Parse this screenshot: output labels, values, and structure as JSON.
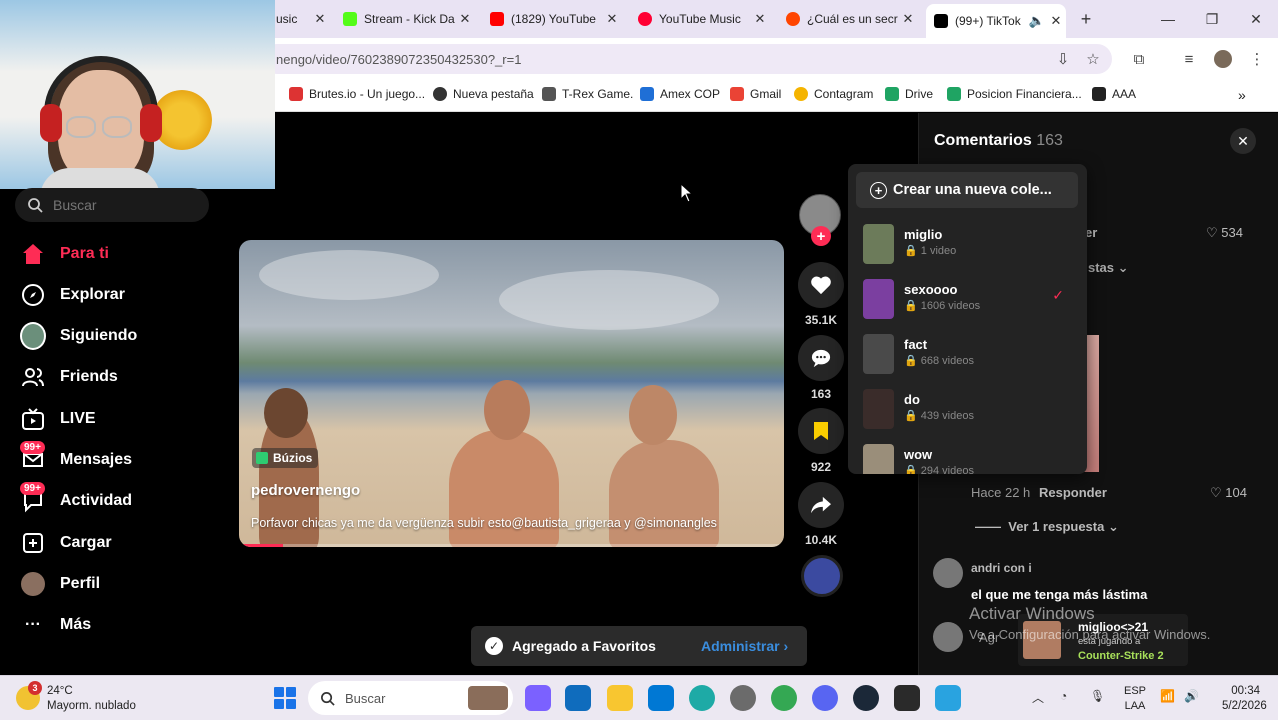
{
  "browser": {
    "tabs": [
      {
        "title": "usic",
        "favicon_color": "#ffffff"
      },
      {
        "title": "Stream - Kick Da",
        "favicon_color": "#53fc18"
      },
      {
        "title": "(1829) YouTube",
        "favicon_color": "#ff0000"
      },
      {
        "title": "YouTube Music",
        "favicon_color": "#ff0033"
      },
      {
        "title": "¿Cuál es un secr",
        "favicon_color": "#ff4500"
      },
      {
        "title": "(99+) TikTok",
        "favicon_color": "#000000"
      }
    ],
    "new_tab_symbol": "+",
    "url": "nengo/video/7602389072350432530?_r=1",
    "bookmarks": [
      {
        "label": "Brutes.io - Un juego...",
        "color": "#d33"
      },
      {
        "label": "Nueva pestaña",
        "color": "#333"
      },
      {
        "label": "T-Rex Game.",
        "color": "#555"
      },
      {
        "label": "Amex COP",
        "color": "#1f6fd6"
      },
      {
        "label": "Gmail",
        "color": "#ea4335"
      },
      {
        "label": "Contagram",
        "color": "#f5b400"
      },
      {
        "label": "Drive",
        "color": "#1fa463"
      },
      {
        "label": "Posicion Financiera...",
        "color": "#1fa463"
      },
      {
        "label": "AAA",
        "color": "#222"
      }
    ]
  },
  "tiktok": {
    "search_placeholder": "Buscar",
    "nav": [
      {
        "label": "Para ti",
        "icon": "home-icon",
        "active": true
      },
      {
        "label": "Explorar",
        "icon": "compass-icon"
      },
      {
        "label": "Siguiendo",
        "icon": "following-avatar-icon"
      },
      {
        "label": "Friends",
        "icon": "friends-icon"
      },
      {
        "label": "LIVE",
        "icon": "live-tv-icon"
      },
      {
        "label": "Mensajes",
        "icon": "messages-icon",
        "badge": "99+"
      },
      {
        "label": "Actividad",
        "icon": "activity-icon",
        "badge": "99+"
      },
      {
        "label": "Cargar",
        "icon": "upload-icon"
      },
      {
        "label": "Perfil",
        "icon": "profile-avatar-icon"
      },
      {
        "label": "Más",
        "icon": "more-icon"
      }
    ],
    "video": {
      "location": "Búzios",
      "username": "pedrovernengo",
      "description": "Porfavor chicas ya me da vergüenza subir esto@bautista_grigeraa y @simonangles",
      "progress": 0.08
    },
    "actions": {
      "likes": "35.1K",
      "comments": "163",
      "saves": "922",
      "shares": "10.4K"
    },
    "comments_panel": {
      "title": "Comentarios",
      "count": "163",
      "visible": [
        {
          "frag": "er",
          "likes": "534"
        },
        {
          "frag": "stas"
        },
        {
          "time": "Hace 22 h",
          "reply": "Responder",
          "likes": "104"
        },
        {
          "more": "Ver 1 respuesta"
        },
        {
          "user": "andri con i",
          "text": "el que me tenga más lástima"
        },
        {
          "frag": "Agr"
        }
      ]
    },
    "collections_popup": {
      "create_label": "Crear una nueva cole...",
      "items": [
        {
          "name": "miglio",
          "count": "1 video",
          "thumb_color": "#6c7b5a"
        },
        {
          "name": "sexoooo",
          "count": "1606 videos",
          "thumb_color": "#7b3fa0",
          "checked": true
        },
        {
          "name": "fact",
          "count": "668 videos",
          "thumb_color": "#4a4a4a"
        },
        {
          "name": "do",
          "count": "439 videos",
          "thumb_color": "#3a2c2a"
        },
        {
          "name": "wow",
          "count": "294 videos",
          "thumb_color": "#9a8e7a"
        }
      ]
    },
    "toast": {
      "message": "Agregado a Favoritos",
      "action": "Administrar"
    }
  },
  "overlays": {
    "activate_windows_title": "Activar Windows",
    "activate_windows_sub": "Ve a Configuración para activar Windows.",
    "stream": {
      "user": "miglioo<>21",
      "status": "está jugando a",
      "game": "Counter-Strike 2"
    }
  },
  "taskbar": {
    "weather_temp": "24°C",
    "weather_desc": "Mayorm. nublado",
    "weather_badge": "3",
    "search_placeholder": "Buscar",
    "lang_line1": "ESP",
    "lang_line2": "LAA",
    "time": "00:34",
    "date": "5/2/2026",
    "apps": [
      {
        "name": "copilot-icon",
        "color": "#7b61ff"
      },
      {
        "name": "outlook-icon",
        "color": "#0f6cbd"
      },
      {
        "name": "file-explorer-icon",
        "color": "#f8c630"
      },
      {
        "name": "store-icon",
        "color": "#0078d4"
      },
      {
        "name": "edge-icon",
        "color": "#1eaaa6"
      },
      {
        "name": "settings-icon",
        "color": "#6b6b6b"
      },
      {
        "name": "chrome-icon",
        "color": "#34a853"
      },
      {
        "name": "discord-icon",
        "color": "#5865f2"
      },
      {
        "name": "steam-icon",
        "color": "#1b2838"
      },
      {
        "name": "epic-games-icon",
        "color": "#2a2a2a"
      },
      {
        "name": "facebook-app-icon",
        "color": "#29a3e0"
      }
    ]
  }
}
